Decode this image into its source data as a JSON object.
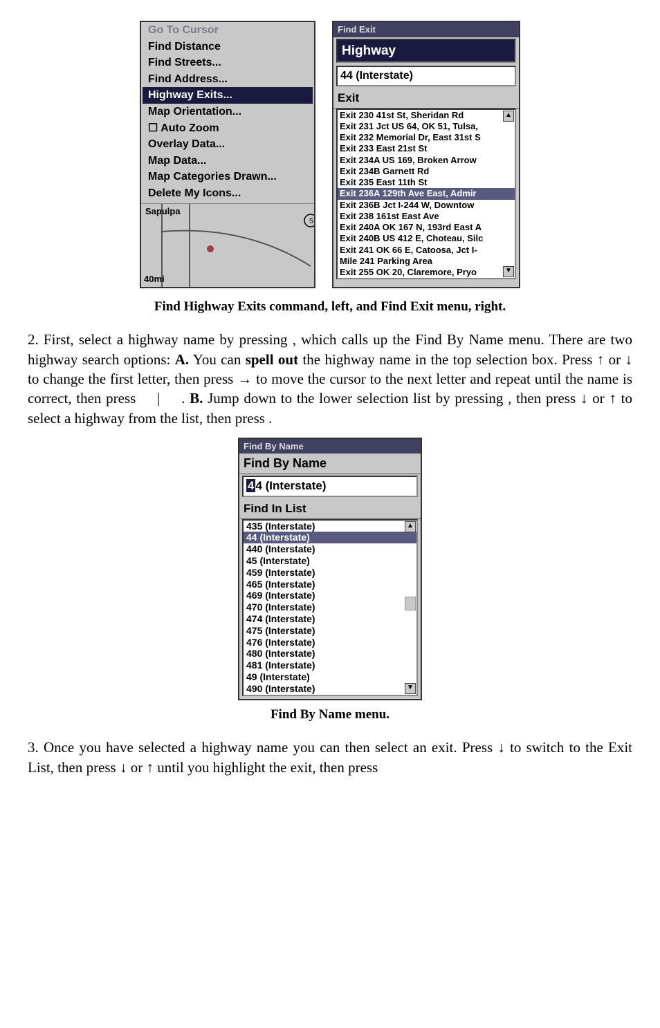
{
  "fig1": {
    "left": {
      "items": [
        {
          "t": "Go To Cursor",
          "dim": true
        },
        {
          "t": "Find Distance"
        },
        {
          "t": "Find Streets..."
        },
        {
          "t": "Find Address..."
        },
        {
          "t": "Highway Exits...",
          "hl": true
        },
        {
          "t": "Map Orientation..."
        },
        {
          "t": "☐ Auto Zoom"
        },
        {
          "t": "Overlay Data..."
        },
        {
          "t": "Map Data..."
        },
        {
          "t": "Map Categories Drawn..."
        },
        {
          "t": "Delete My Icons..."
        }
      ],
      "map_city": "Sapulpa",
      "map_scale": "40mi"
    },
    "right": {
      "title": "Find Exit",
      "highway_label": "Highway",
      "highway_value": "44 (Interstate)",
      "exit_label": "Exit",
      "rows": [
        {
          "t": "Exit 230 41st St, Sheridan Rd"
        },
        {
          "t": "Exit 231 Jct US 64, OK 51, Tulsa,"
        },
        {
          "t": "Exit 232 Memorial Dr, East 31st S"
        },
        {
          "t": "Exit 233 East 21st St"
        },
        {
          "t": "Exit 234A US 169, Broken Arrow"
        },
        {
          "t": "Exit 234B Garnett Rd"
        },
        {
          "t": "Exit 235 East 11th St"
        },
        {
          "t": "Exit 236A 129th Ave East, Admir",
          "hl": true
        },
        {
          "t": "Exit 236B Jct I-244 W, Downtow"
        },
        {
          "t": "Exit 238 161st East Ave"
        },
        {
          "t": "Exit 240A OK 167 N, 193rd East A"
        },
        {
          "t": "Exit 240B US 412 E, Choteau, Silc"
        },
        {
          "t": "Exit 241 OK 66 E, Catoosa, Jct I-"
        },
        {
          "t": "Mile 241 Parking Area"
        },
        {
          "t": "Exit 255 OK 20, Claremore, Pryo"
        }
      ]
    }
  },
  "caption1": "Find Highway Exits command, left, and Find Exit menu, right.",
  "para2_a": "2. First, select a highway name by pressing ",
  "para2_b": ", which calls up the Find By Name menu. There are two highway search options: ",
  "para2_bold_A": "A.",
  "para2_c": " You can ",
  "para2_bold_spell": "spell out",
  "para2_d": " the highway name in the top selection box. Press ↑ or ↓ to change the first letter, then press → to move the cursor to the next letter and repeat until the name is correct, then press ",
  "para2_e": "|",
  "para2_f": ". ",
  "para2_bold_B": "B.",
  "para2_g": " Jump down to the lower selection list by pressing ",
  "para2_h": ", then press ↓ or ↑ to select a highway from the list, then press ",
  "para2_i": ".",
  "fig2": {
    "title": "Find By Name",
    "header": "Find By Name",
    "input": "44 (Interstate)",
    "list_label": "Find In List",
    "rows": [
      {
        "t": "435 (Interstate)"
      },
      {
        "t": "44 (Interstate)",
        "hl": true
      },
      {
        "t": "440 (Interstate)"
      },
      {
        "t": "45 (Interstate)"
      },
      {
        "t": "459 (Interstate)"
      },
      {
        "t": "465 (Interstate)"
      },
      {
        "t": "469 (Interstate)"
      },
      {
        "t": "470 (Interstate)"
      },
      {
        "t": "474 (Interstate)"
      },
      {
        "t": "475 (Interstate)"
      },
      {
        "t": "476 (Interstate)"
      },
      {
        "t": "480 (Interstate)"
      },
      {
        "t": "481 (Interstate)"
      },
      {
        "t": "49 (Interstate)"
      },
      {
        "t": "490 (Interstate)"
      }
    ]
  },
  "caption2": "Find By Name menu.",
  "para3": "3. Once you have selected a highway name you can then select an exit. Press ↓ to switch to the Exit List, then press ↓ or ↑ until you highlight the exit, then press"
}
